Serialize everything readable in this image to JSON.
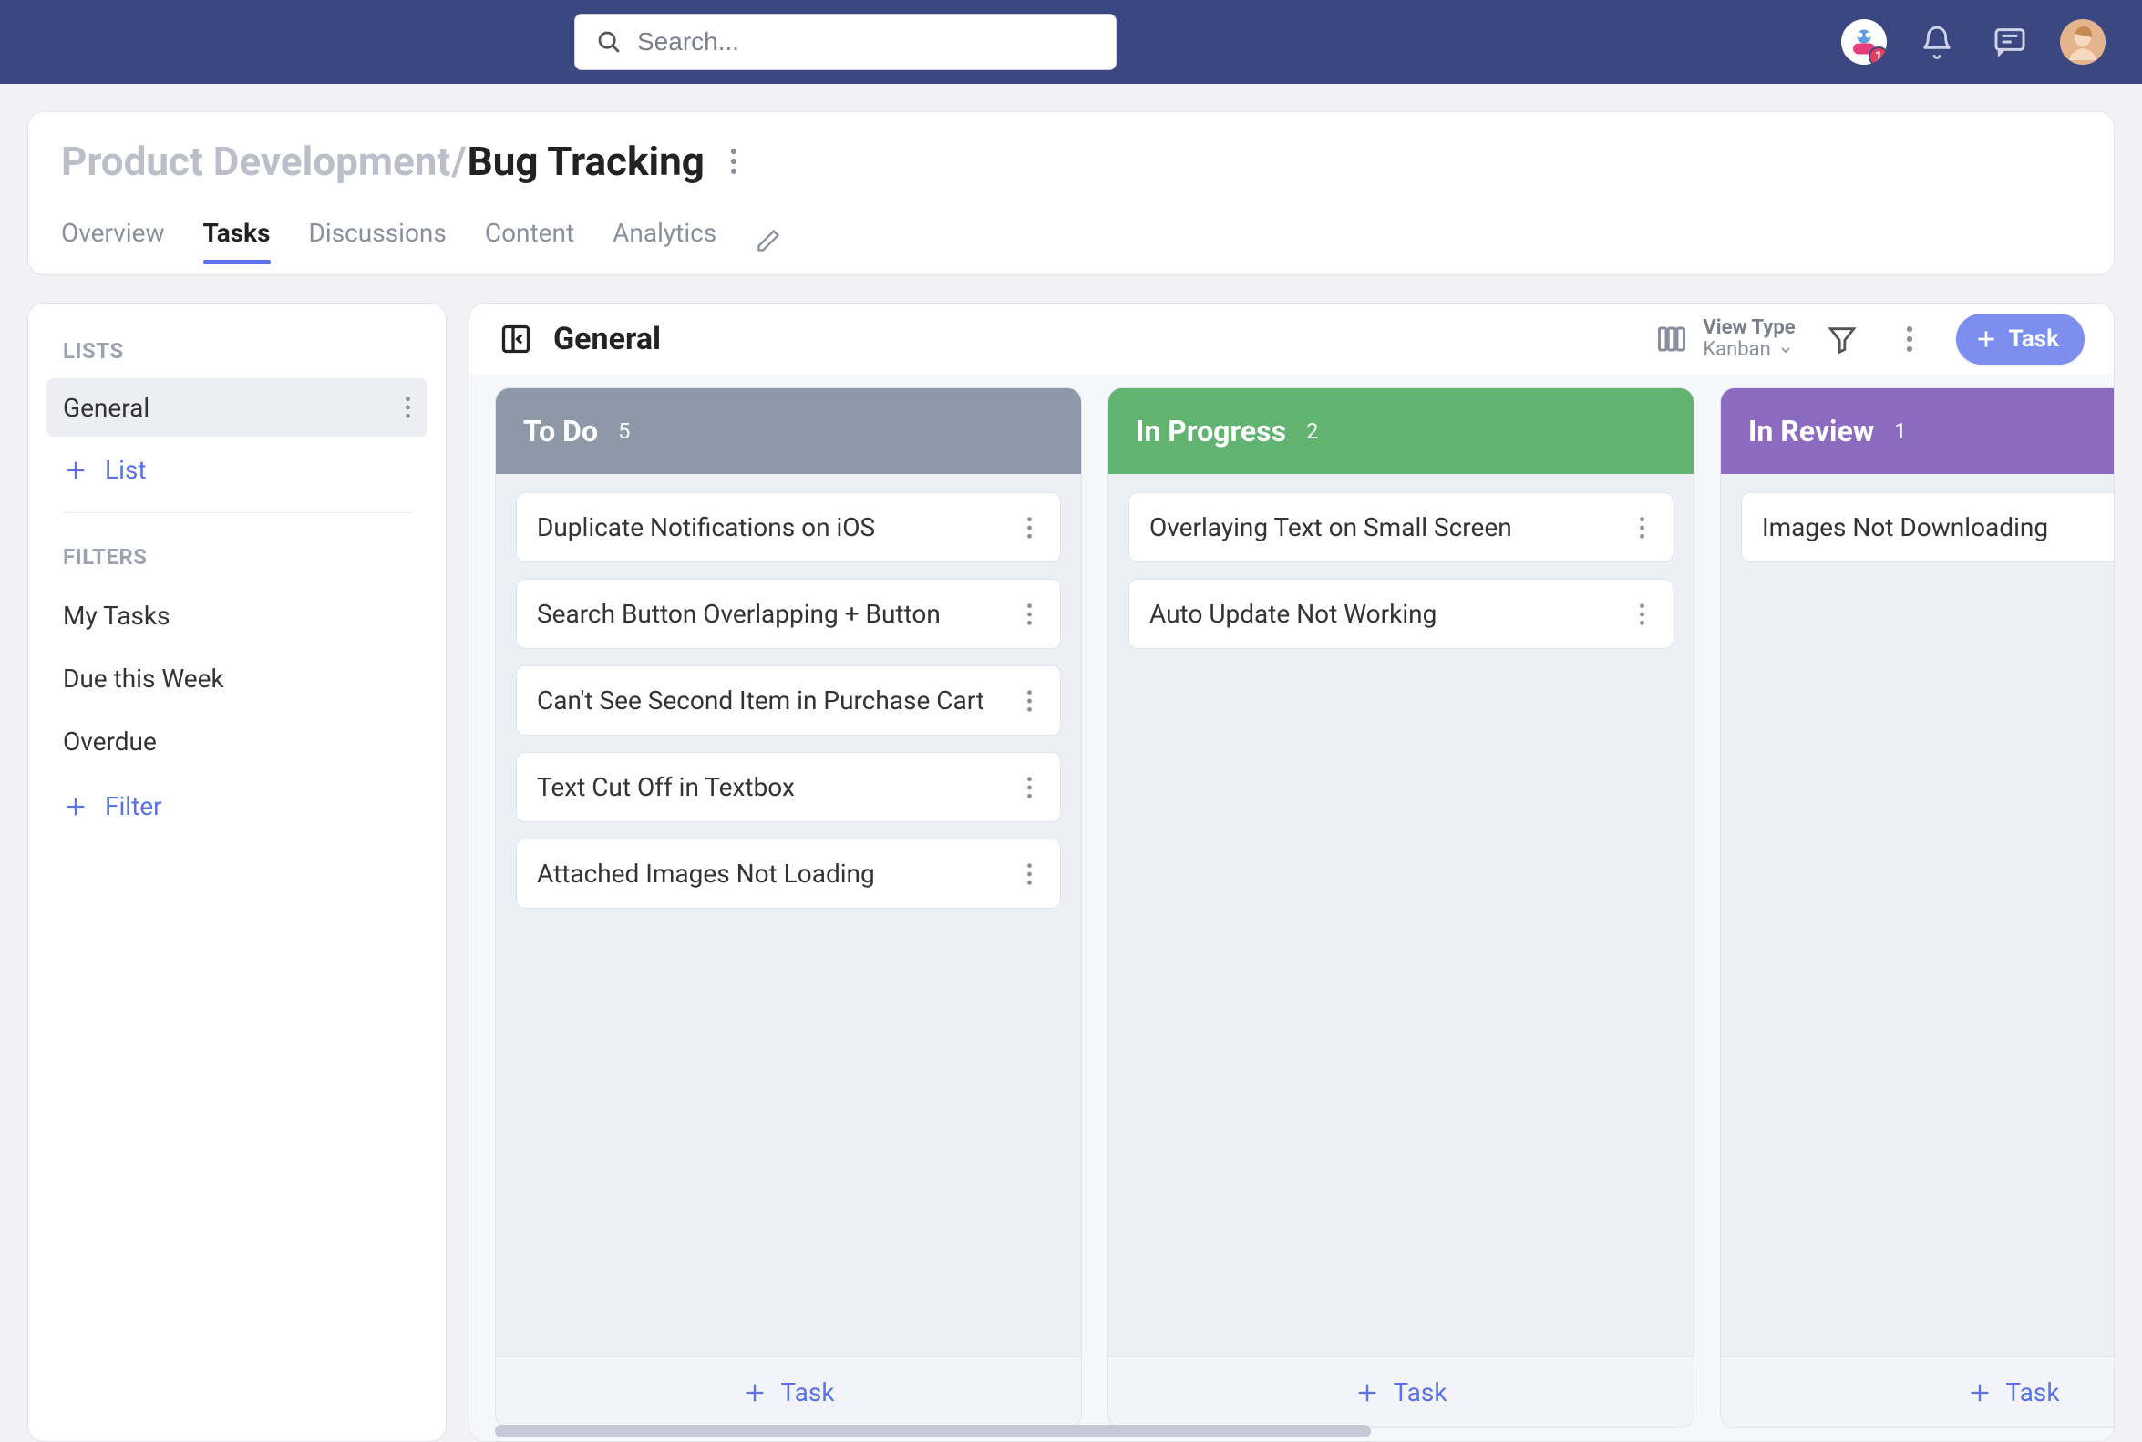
{
  "topbar": {
    "search_placeholder": "Search...",
    "bot_badge": "1"
  },
  "breadcrumb": {
    "parent": "Product Development",
    "current": "Bug Tracking"
  },
  "tabs": [
    {
      "label": "Overview",
      "active": false
    },
    {
      "label": "Tasks",
      "active": true
    },
    {
      "label": "Discussions",
      "active": false
    },
    {
      "label": "Content",
      "active": false
    },
    {
      "label": "Analytics",
      "active": false
    }
  ],
  "sidebar": {
    "lists_label": "LISTS",
    "lists": [
      {
        "label": "General",
        "active": true
      }
    ],
    "add_list_label": "List",
    "filters_label": "FILTERS",
    "filters": [
      {
        "label": "My Tasks"
      },
      {
        "label": "Due this Week"
      },
      {
        "label": "Overdue"
      }
    ],
    "add_filter_label": "Filter"
  },
  "board": {
    "title": "General",
    "view_type_label": "View Type",
    "view_type_value": "Kanban",
    "new_task_label": "Task",
    "add_task_label": "Task",
    "columns": [
      {
        "name": "To Do",
        "count": "5",
        "color": "grey",
        "cards": [
          {
            "title": "Duplicate Notifications on iOS"
          },
          {
            "title": "Search Button Overlapping + Button"
          },
          {
            "title": "Can't See Second Item in Purchase Cart"
          },
          {
            "title": "Text Cut Off in Textbox"
          },
          {
            "title": "Attached Images Not Loading"
          }
        ]
      },
      {
        "name": "In Progress",
        "count": "2",
        "color": "green",
        "cards": [
          {
            "title": "Overlaying Text on Small Screen"
          },
          {
            "title": "Auto Update Not Working"
          }
        ]
      },
      {
        "name": "In Review",
        "count": "1",
        "color": "purple",
        "cards": [
          {
            "title": "Images Not Downloading"
          }
        ]
      }
    ]
  }
}
